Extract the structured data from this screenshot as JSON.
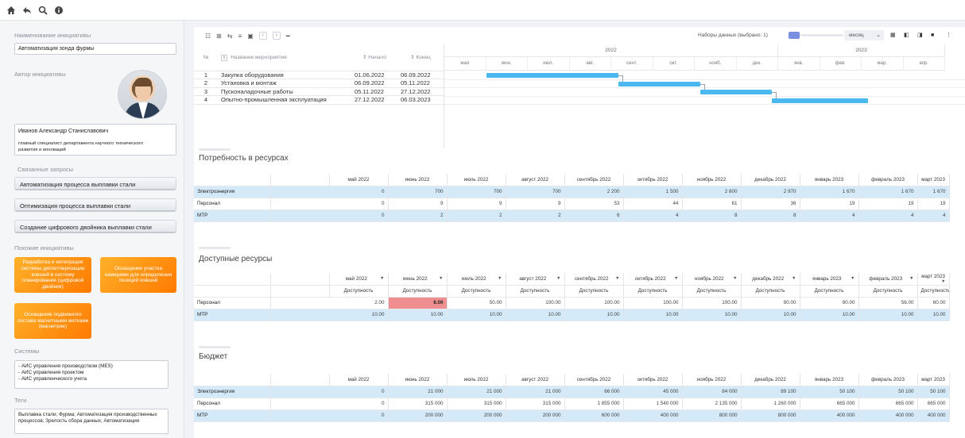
{
  "toolbar": {
    "icons": [
      "home-icon",
      "back-icon",
      "search-icon",
      "info-icon"
    ]
  },
  "left": {
    "initiative_name_label": "Наименование инициативы",
    "initiative_name": "Автоматизация зонда фурмы",
    "author_label": "Автор инициативы",
    "author_name": "Иванов Александр Станиславович",
    "author_position": "главный специалист департамента научного технического развития и инноваций",
    "related_label": "Связанные запросы",
    "related": [
      "Автоматизация процесса выплавки стали",
      "Оптимизация процесса выплавки стали",
      "Создание цифрового двойника выплавки стали"
    ],
    "similar_label": "Похожие инициативы",
    "similar": [
      "Разработка и интеграция системы диспетчеризации ковшей в систему планирования (цифровой двойник)",
      "Оснащение участка камерами для определения позиций ковшей",
      "Оснащение подвижного состава магнитными метками (магнитрек)"
    ],
    "systems_label": "Системы",
    "systems": [
      "- АИС управления производством (MES)",
      "- АИС управления проектом",
      "- АИС управленческого учета"
    ],
    "tags_label": "Теги",
    "tags": "Выплавка стали; Фурма; Автоматизация производственных процессов; Зрелость сбора данных; Автоматизация"
  },
  "gantt": {
    "datasets_label": "Наборы данных (выбрано: 1)",
    "scale": "месяц",
    "col_num": "№",
    "col_name": "Название мероприятия",
    "col_start": "Начало",
    "col_end": "Конец",
    "years": [
      "2022",
      "2023"
    ],
    "months": [
      "мая",
      "июн.",
      "июл.",
      "авг.",
      "сент.",
      "окт.",
      "нояб.",
      "дек.",
      "янв.",
      "фев.",
      "мар.",
      "апр."
    ],
    "tasks": [
      {
        "n": "1",
        "name": "Закупка оборудования",
        "start": "01.06.2022",
        "end": "06.09.2022"
      },
      {
        "n": "2",
        "name": "Установка и монтаж",
        "start": "06.09.2022",
        "end": "05.11.2022"
      },
      {
        "n": "3",
        "name": "Пусконаладочные работы",
        "start": "05.11.2022",
        "end": "27.12.2022"
      },
      {
        "n": "4",
        "name": "Опытно-промышленная эксплуатация",
        "start": "27.12.2022",
        "end": "06.03.2023"
      }
    ],
    "bar_color": "#4cb8f0"
  },
  "months_cols": [
    "май 2022",
    "июнь 2022",
    "июль 2022",
    "август 2022",
    "сентябрь 2022",
    "октябрь 2022",
    "ноябрь 2022",
    "декабрь 2022",
    "январь 2023",
    "февраль 2023",
    "март 2023",
    "апрел"
  ],
  "resources": {
    "title": "Потребность в ресурсах",
    "rows": [
      {
        "label": "Электроэнергия",
        "values": [
          "0",
          "700",
          "700",
          "700",
          "2 200",
          "1 500",
          "2 800",
          "2 970",
          "1 670",
          "1 670",
          "1 670",
          ""
        ],
        "hl": true
      },
      {
        "label": "Персонал",
        "values": [
          "0",
          "9",
          "9",
          "9",
          "53",
          "44",
          "61",
          "36",
          "19",
          "19",
          "19",
          ""
        ],
        "hl": false
      },
      {
        "label": "МТР",
        "values": [
          "0",
          "2",
          "2",
          "2",
          "6",
          "4",
          "8",
          "8",
          "4",
          "4",
          "4",
          ""
        ],
        "hl": true
      }
    ]
  },
  "available": {
    "title": "Доступные ресурсы",
    "sub": "Доступность",
    "sub_last": "Досту",
    "rows": [
      {
        "label": "Персонал",
        "values": [
          "2.00",
          "8.00",
          "50.00",
          "100.00",
          "100.00",
          "100.00",
          "100.00",
          "90.00",
          "90.00",
          "56.00",
          "60.00",
          ""
        ],
        "hl": false,
        "red_index": 1
      },
      {
        "label": "МТР",
        "values": [
          "10.00",
          "10.00",
          "10.00",
          "10.00",
          "10.00",
          "10.00",
          "10.00",
          "10.00",
          "10.00",
          "10.00",
          "10.00",
          ""
        ],
        "hl": true,
        "red_index": -1
      }
    ]
  },
  "budget": {
    "title": "Бюджет",
    "rows": [
      {
        "label": "Электроэнергия",
        "values": [
          "0",
          "21 000",
          "21 000",
          "21 000",
          "66 000",
          "45 000",
          "84 000",
          "89 100",
          "50 100",
          "50 100",
          "50 100",
          ""
        ],
        "hl": true
      },
      {
        "label": "Персонал",
        "values": [
          "0",
          "315 000",
          "315 000",
          "315 000",
          "1 855 000",
          "1 540 000",
          "2 135 000",
          "1 260 000",
          "665 000",
          "665 000",
          "665 000",
          ""
        ],
        "hl": false
      },
      {
        "label": "МТР",
        "values": [
          "0",
          "200 000",
          "200 000",
          "200 000",
          "600 000",
          "400 000",
          "800 000",
          "800 000",
          "400 000",
          "400 000",
          "400 000",
          ""
        ],
        "hl": true
      }
    ]
  }
}
